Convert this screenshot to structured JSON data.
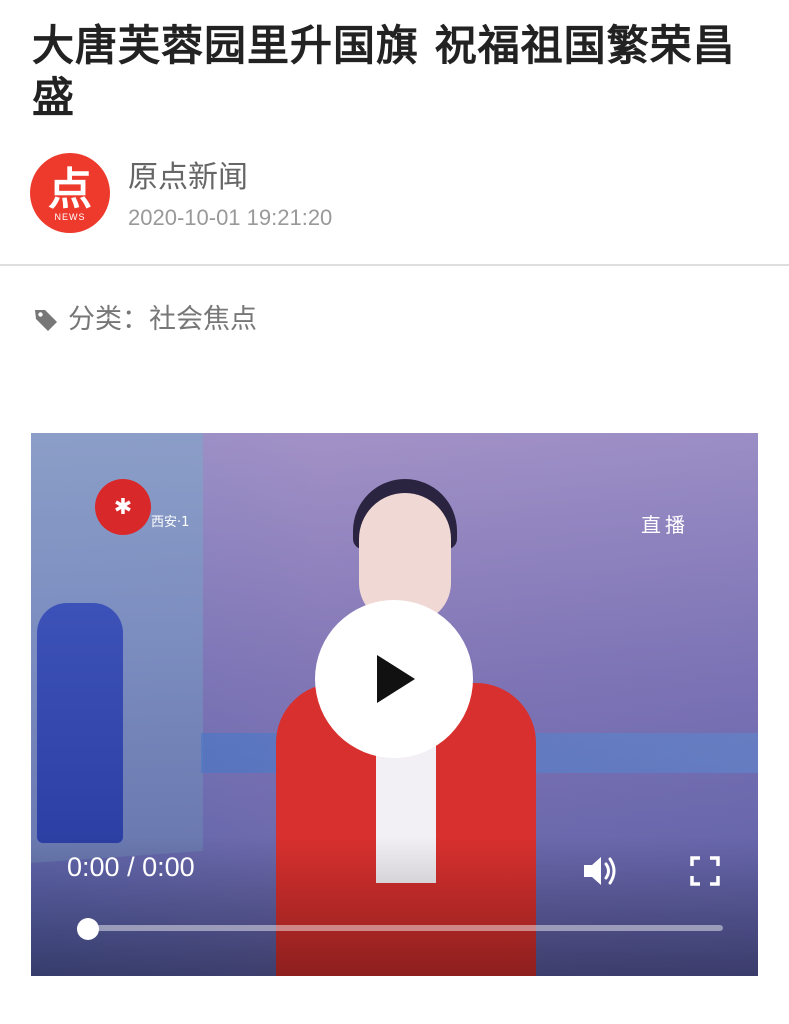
{
  "article": {
    "title": "大唐芙蓉园里升国旗 祝福祖国繁荣昌盛",
    "source_logo_glyph": "点",
    "source_logo_text": "NEWS",
    "source_name": "原点新闻",
    "publish_time": "2020-10-01 19:21:20",
    "category": "分类：社会焦点"
  },
  "video": {
    "channel_name": "西安·1",
    "live_tag": "直播",
    "current_time": "0:00",
    "duration": "0:00",
    "time_separator": " / ",
    "progress": 0,
    "accent": "#ffffff"
  },
  "icons": {
    "tag": "tag-icon",
    "play": "play-icon",
    "volume": "volume-icon",
    "fullscreen": "fullscreen-icon"
  },
  "colors": {
    "brand": "#ee3a2c",
    "title": "#222222",
    "muted": "#999999"
  }
}
